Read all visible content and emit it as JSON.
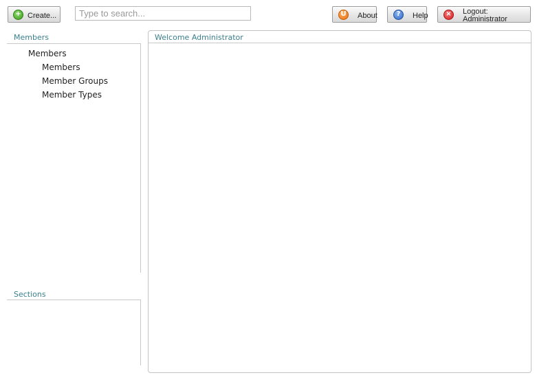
{
  "toolbar": {
    "create_label": "Create...",
    "search_placeholder": "Type to search...",
    "about_label": "About",
    "help_label": "Help",
    "logout_label": "Logout: Administrator"
  },
  "icons": {
    "create": "plus-circle-icon",
    "about": "umbraco-logo-icon",
    "help": "question-circle-icon",
    "logout": "close-circle-icon"
  },
  "tree": {
    "title": "Members",
    "root": "Members",
    "children": [
      "Members",
      "Member Groups",
      "Member Types"
    ]
  },
  "sections": {
    "title": "Sections"
  },
  "main": {
    "title": "Welcome Administrator"
  },
  "colors": {
    "pane_title": "#3a7f8c",
    "border": "#c8c8c8"
  }
}
